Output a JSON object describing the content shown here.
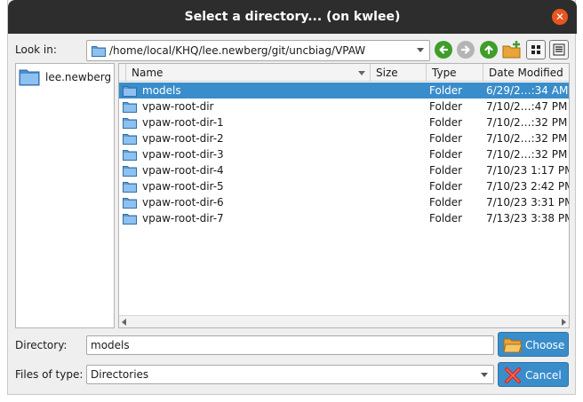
{
  "window": {
    "title": "Select a directory... (on kwlee)"
  },
  "lookin": {
    "label": "Look in:",
    "path": "/home/local/KHQ/lee.newberg/git/uncbiag/VPAW"
  },
  "sidebar": {
    "items": [
      {
        "label": "lee.newberg"
      }
    ]
  },
  "columns": {
    "name": "Name",
    "size": "Size",
    "type": "Type",
    "date": "Date Modified"
  },
  "files": [
    {
      "name": "models",
      "type": "Folder",
      "date": "6/29/2…:34 AM"
    },
    {
      "name": "vpaw-root-dir",
      "type": "Folder",
      "date": "7/10/2…:47 PM"
    },
    {
      "name": "vpaw-root-dir-1",
      "type": "Folder",
      "date": "7/10/2…:32 PM"
    },
    {
      "name": "vpaw-root-dir-2",
      "type": "Folder",
      "date": "7/10/2…:32 PM"
    },
    {
      "name": "vpaw-root-dir-3",
      "type": "Folder",
      "date": "7/10/2…:32 PM"
    },
    {
      "name": "vpaw-root-dir-4",
      "type": "Folder",
      "date": "7/10/23 1:17 PM"
    },
    {
      "name": "vpaw-root-dir-5",
      "type": "Folder",
      "date": "7/10/23 2:42 PM"
    },
    {
      "name": "vpaw-root-dir-6",
      "type": "Folder",
      "date": "7/10/23 3:31 PM"
    },
    {
      "name": "vpaw-root-dir-7",
      "type": "Folder",
      "date": "7/13/23 3:38 PM"
    }
  ],
  "directory": {
    "label": "Directory:",
    "value": "models"
  },
  "filetype": {
    "label": "Files of type:",
    "value": "Directories"
  },
  "buttons": {
    "choose": "Choose",
    "cancel": "Cancel"
  },
  "colors": {
    "accent": "#3a8dcb",
    "titlebar": "#2d2d2d",
    "close": "#e95420",
    "nav_green": "#3f9d2a"
  }
}
